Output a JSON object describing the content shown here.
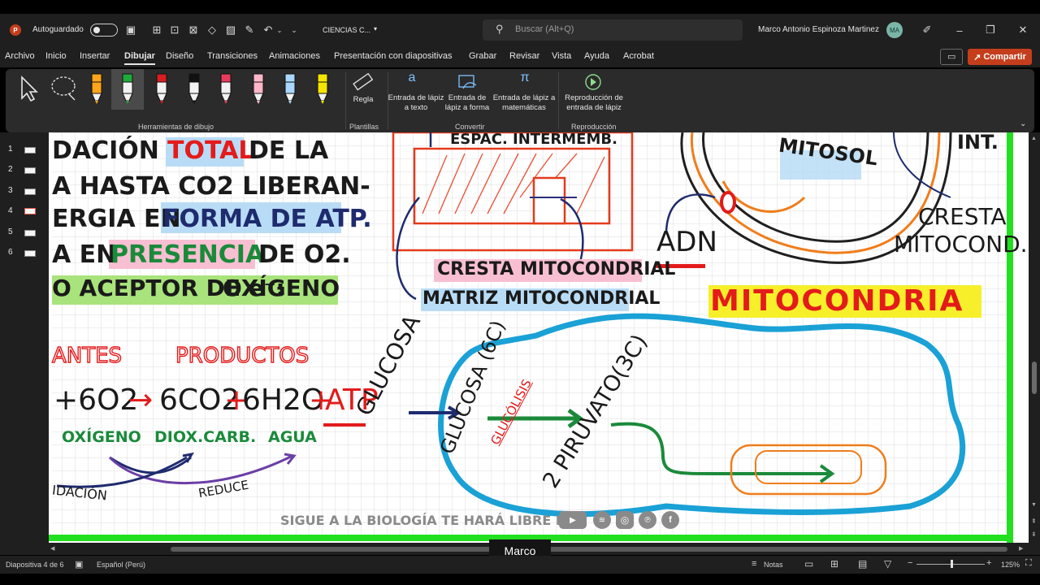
{
  "titlebar": {
    "autosave_label": "Autoguardado",
    "file_name": "CIENCIAS C...",
    "search_placeholder": "Buscar (Alt+Q)",
    "user_name": "Marco Antonio Espinoza Martinez",
    "user_initials": "MA"
  },
  "menu": {
    "items": [
      "Archivo",
      "Inicio",
      "Insertar",
      "Dibujar",
      "Diseño",
      "Transiciones",
      "Animaciones",
      "Presentación con diapositivas",
      "Grabar",
      "Revisar",
      "Vista",
      "Ayuda",
      "Acrobat"
    ],
    "active": "Dibujar",
    "share_label": "Compartir"
  },
  "ribbon": {
    "groups": {
      "drawing_tools": "Herramientas de dibujo",
      "templates": "Plantillas",
      "convert": "Convertir",
      "replay": "Reproducción"
    },
    "buttons": {
      "ruler": "Regla",
      "ink_to_text": "Entrada de lápiz a texto",
      "ink_to_shape": "Entrada de lápiz a forma",
      "ink_to_math": "Entrada de lápiz a matemáticas",
      "ink_replay": "Reproducción de entrada de lápiz"
    },
    "pen_colors": [
      "#ffa41b",
      "#1faa3c",
      "#d81e1e",
      "#111111",
      "#e83b5b",
      "#ffb6c8",
      "#a8d8ff",
      "#f5e500"
    ]
  },
  "thumbnails": [
    "1",
    "2",
    "3",
    "4",
    "5",
    "6"
  ],
  "slide": {
    "left_lines": [
      "DACIÓN",
      "TOTAL",
      "DE LA",
      "A HASTA CO2 LIBERAN-",
      "ERGIA EN",
      "FORMA DE ATP.",
      "A EN",
      "PRESENCIA",
      "DE O2.",
      "O ACEPTOR DE e⁻:",
      "OXÍGENO"
    ],
    "headers": [
      "ANTES",
      "PRODUCTOS"
    ],
    "equation_parts": [
      "+6O2",
      "→",
      "6CO2",
      "+",
      "6H2O",
      "+",
      "ATP"
    ],
    "equation_labels": [
      "OXÍGENO",
      "DIOX.CARB.",
      "AGUA"
    ],
    "oxid_label": "IDACIÓN",
    "reduce_label": "REDUCE",
    "espac_label": "ESPAC. INTERMEMB.",
    "cresta_label": "CRESTA MITOCONDRIAL",
    "matriz_label": "MATRIZ MITOCONDRIAL",
    "mitosol_label": "MITOSOL",
    "int_label": "INT.",
    "adn_label": "ADN",
    "cresta_mito_label": "CRESTA",
    "cresta_mito_label2": "MITOCOND.",
    "mitocondria_title": "MITOCONDRIA",
    "glucosa_label": "GLUCOSA",
    "glucosa6c_label": "GLUCOSA (6C)",
    "glucolisis_label": "GLUCÓLISIS",
    "piruvato_label": "2 PIRUVATO(3C)",
    "footer_text": "SIGUE A LA BIOLOGÍA TE HARÁ LIBRE EN"
  },
  "caption": "Marco",
  "status": {
    "slide_info": "Diapositiva 4 de 6",
    "language": "Español (Perú)",
    "notes_label": "Notas",
    "zoom": "125%"
  }
}
